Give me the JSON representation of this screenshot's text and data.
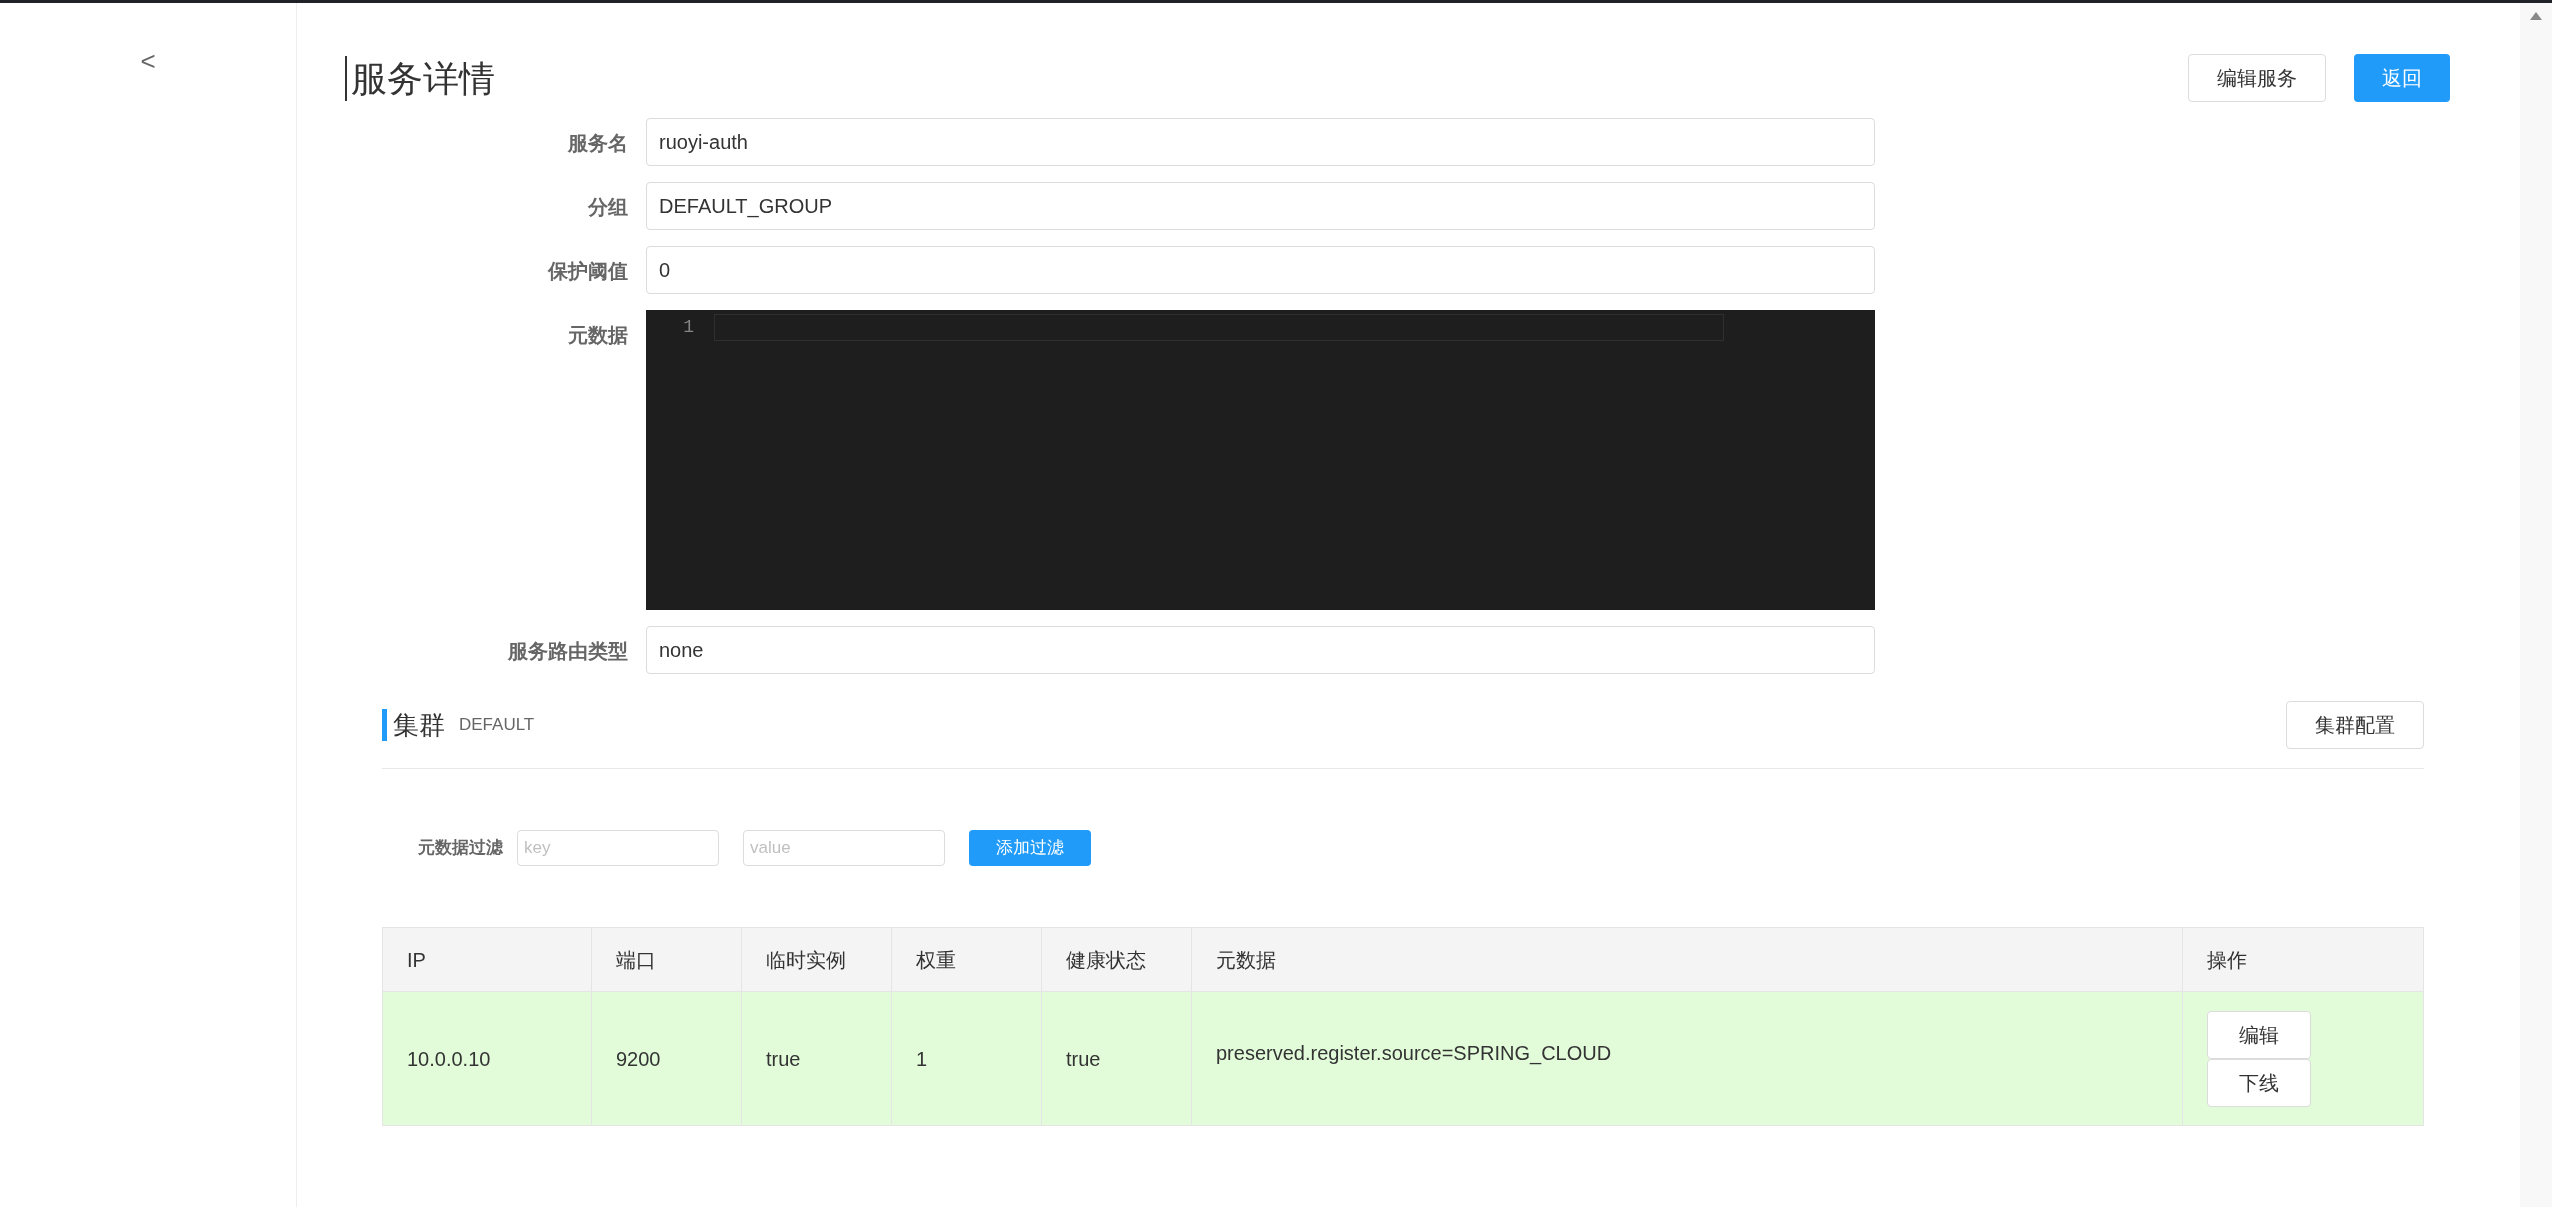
{
  "back_button": {
    "label": "<"
  },
  "title": "服务详情",
  "header_buttons": [
    {
      "label": "编辑服务",
      "kind": "default"
    },
    {
      "label": "返回",
      "kind": "primary"
    }
  ],
  "form": {
    "fields": [
      {
        "label": "服务名",
        "kind": "input",
        "value": "ruoyi-auth"
      },
      {
        "label": "分组",
        "kind": "input",
        "value": "DEFAULT_GROUP"
      },
      {
        "label": "保护阈值",
        "kind": "input",
        "value": "0"
      },
      {
        "label": "元数据",
        "kind": "editor",
        "line_numbers": [
          "1"
        ]
      },
      {
        "label": "服务路由类型",
        "kind": "input",
        "value": "none"
      }
    ]
  },
  "cluster": {
    "title": "集群",
    "name": "DEFAULT",
    "config_button": "集群配置",
    "filter": {
      "label": "元数据过滤",
      "key_placeholder": "key",
      "value_placeholder": "value",
      "add_button": "添加过滤"
    },
    "table": {
      "columns": [
        "IP",
        "端口",
        "临时实例",
        "权重",
        "健康状态",
        "元数据",
        "操作"
      ],
      "rows": [
        {
          "enabled": true,
          "cells": [
            "10.0.0.10",
            "9200",
            "true",
            "1",
            "true",
            "preserved.register.source=SPRING_CLOUD"
          ],
          "actions": [
            "编辑",
            "下线"
          ]
        }
      ]
    }
  }
}
